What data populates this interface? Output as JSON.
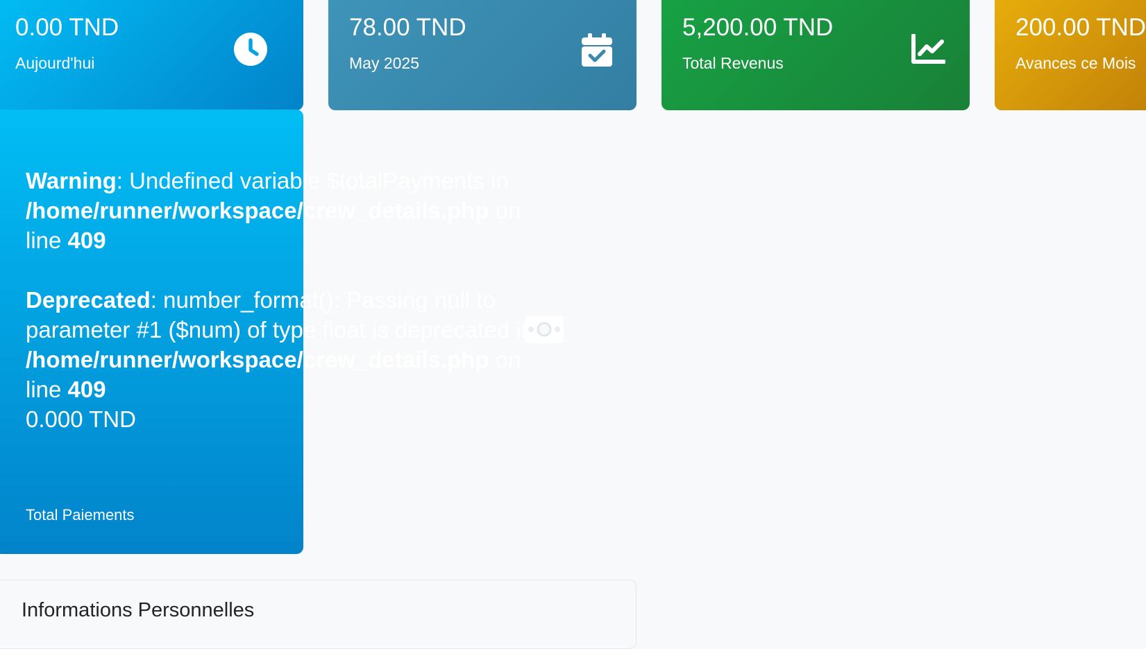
{
  "stats": {
    "today": {
      "amount": "0.00 TND",
      "label": "Aujourd'hui",
      "icon": "clock-icon",
      "color": "#02bdf5"
    },
    "month": {
      "amount": "78.00 TND",
      "label": "May 2025",
      "icon": "calendar-check-icon",
      "color": "#3f94b9"
    },
    "revenue": {
      "amount": "5,200.00 TND",
      "label": "Total Revenus",
      "icon": "chart-line-icon",
      "color": "#17a245"
    },
    "advances": {
      "amount": "200.00 TND",
      "label": "Avances ce Mois",
      "color": "#e8ae0b"
    }
  },
  "payments": {
    "warning": {
      "kind": "Warning",
      "message": ": Undefined variable $totalPayments in ",
      "file": "/home/runner/workspace/crew_details.php",
      "on_line": " on line ",
      "line": "409"
    },
    "deprecated": {
      "kind": "Deprecated",
      "message": ": number_format(): Passing null to parameter #1 ($num) of type float is deprecated in ",
      "file": "/home/runner/workspace/crew_details.php",
      "on_line": " on line ",
      "line": "409"
    },
    "amount": "0.000 TND",
    "label": "Total Paiements",
    "icon": "money-bill-icon"
  },
  "info": {
    "title": "Informations Personnelles"
  }
}
